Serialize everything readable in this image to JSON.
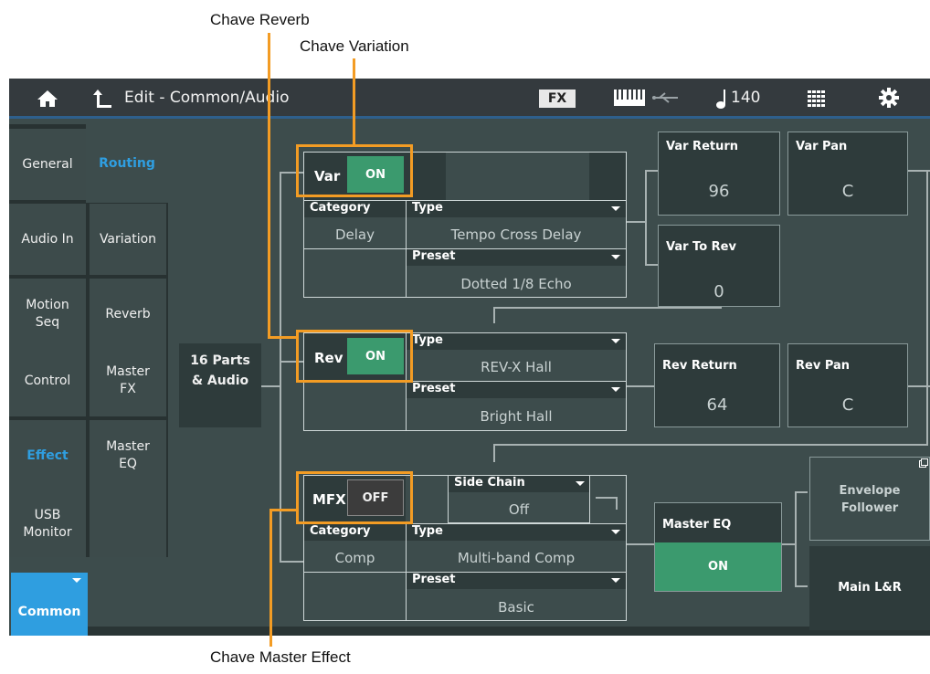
{
  "callouts": {
    "reverb": "Chave Reverb",
    "variation": "Chave Variation",
    "master_effect": "Chave Master Effect"
  },
  "topbar": {
    "title": "Edit - Common/Audio",
    "fx_label": "FX",
    "tempo": "140",
    "icons": [
      "home-icon",
      "back-arrow-icon",
      "keyboard-icon",
      "usb-icon",
      "quarter-note-icon",
      "grid-icon",
      "gear-icon"
    ]
  },
  "left_tabs": {
    "col1": [
      "General",
      "Audio In",
      "Motion Seq",
      "Control",
      "Effect",
      "USB Monitor"
    ],
    "col2": [
      "Routing",
      "Variation",
      "Reverb",
      "Master FX",
      "Master EQ"
    ],
    "common": "Common"
  },
  "routing": {
    "source": "16 Parts & Audio",
    "var": {
      "label": "Var",
      "switch": "ON",
      "category_label": "Category",
      "category": "Delay",
      "type_label": "Type",
      "type": "Tempo Cross Delay",
      "preset_label": "Preset",
      "preset": "Dotted 1/8 Echo"
    },
    "rev": {
      "label": "Rev",
      "switch": "ON",
      "type_label": "Type",
      "type": "REV-X Hall",
      "preset_label": "Preset",
      "preset": "Bright Hall"
    },
    "mfx": {
      "label": "MFX",
      "switch": "OFF",
      "side_chain_label": "Side Chain",
      "side_chain": "Off",
      "category_label": "Category",
      "category": "Comp",
      "type_label": "Type",
      "type": "Multi-band Comp",
      "preset_label": "Preset",
      "preset": "Basic"
    },
    "var_return": {
      "label": "Var Return",
      "value": "96"
    },
    "var_pan": {
      "label": "Var Pan",
      "value": "C"
    },
    "var_to_rev": {
      "label": "Var To Rev",
      "value": "0"
    },
    "rev_return": {
      "label": "Rev Return",
      "value": "64"
    },
    "rev_pan": {
      "label": "Rev Pan",
      "value": "C"
    },
    "master_eq": {
      "label": "Master EQ",
      "switch": "ON"
    },
    "envelope_follower": "Envelope Follower",
    "main_lr": "Main L&R"
  },
  "colors": {
    "screen_bg": "#3d4c4c",
    "topbar_bg": "#343a3e",
    "accent_blue": "#2f9ee0",
    "on_green": "#3b9a6e",
    "highlight_orange": "#f39c24"
  }
}
